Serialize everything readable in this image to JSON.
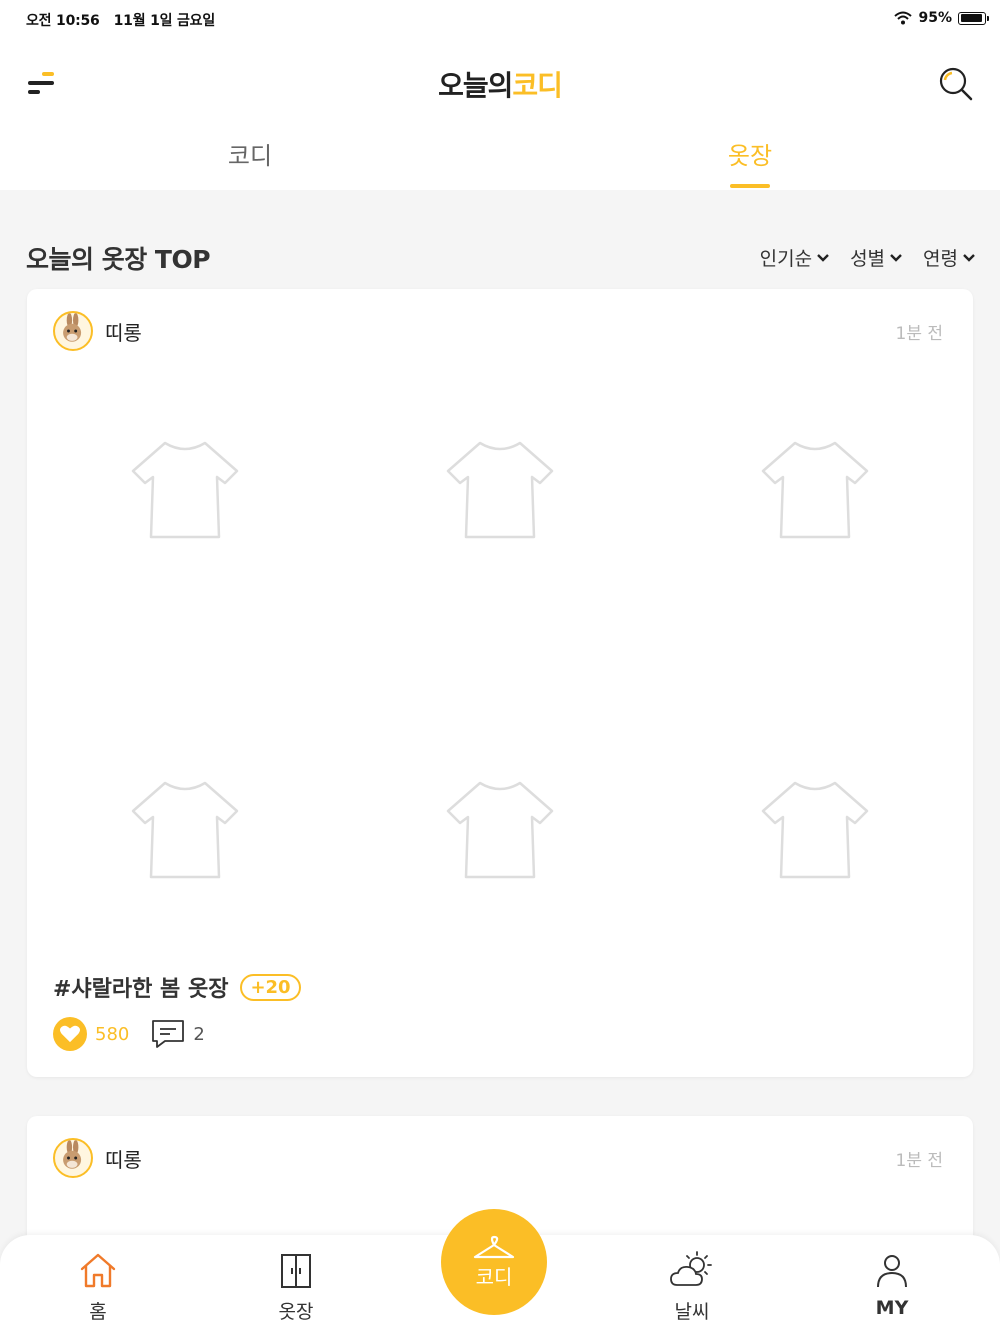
{
  "status_bar": {
    "time": "오전 10:56",
    "date": "11월 1일 금요일",
    "battery": "95%",
    "battery_level": 0.95
  },
  "header": {
    "logo_part1": "오늘의",
    "logo_part2": "코디",
    "tabs": [
      {
        "label": "코디",
        "active": false
      },
      {
        "label": "옷장",
        "active": true
      }
    ]
  },
  "section": {
    "title": "오늘의 옷장 TOP",
    "filters": [
      {
        "label": "인기순"
      },
      {
        "label": "성별"
      },
      {
        "label": "연령"
      }
    ]
  },
  "cards": [
    {
      "username": "띠롱",
      "time": "1분 전",
      "items": [
        "tshirt-icon",
        "tshirt-icon",
        "tshirt-icon",
        "tshirt-icon",
        "tshirt-icon",
        "tshirt-icon"
      ],
      "tag": "#샤랄라한 봄 옷장",
      "extra_count": "+20",
      "likes": "580",
      "comments": "2"
    },
    {
      "username": "띠롱",
      "time": "1분 전"
    }
  ],
  "bottom_nav": {
    "home": "홈",
    "closet": "옷장",
    "center": "코디",
    "weather": "날씨",
    "my": "MY"
  },
  "colors": {
    "accent": "#fbbe26",
    "home_icon": "#f07a2a"
  }
}
